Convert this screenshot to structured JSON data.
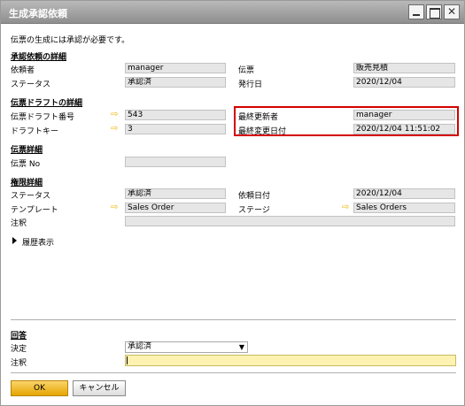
{
  "window": {
    "title": "生成承認依頼"
  },
  "info_text": "伝票の生成には承認が必要です。",
  "approval_details": {
    "heading": "承認依頼の詳細",
    "requester_label": "依頼者",
    "requester_value": "manager",
    "document_label": "伝票",
    "document_value": "販売見積",
    "status_label": "ステータス",
    "status_value": "承認済",
    "issue_date_label": "発行日",
    "issue_date_value": "2020/12/04"
  },
  "draft_details": {
    "heading": "伝票ドラフトの詳細",
    "draft_number_label": "伝票ドラフト番号",
    "draft_number_value": "543",
    "draft_key_label": "ドラフトキー",
    "draft_key_value": "3",
    "last_updated_by_label": "最終更新者",
    "last_updated_by_value": "manager",
    "last_modified_label": "最終変更日付",
    "last_modified_value": "2020/12/04 11:51:02"
  },
  "document_details": {
    "heading": "伝票詳細",
    "doc_no_label": "伝票 No",
    "doc_no_value": ""
  },
  "authorization_details": {
    "heading": "権限詳細",
    "status_label": "ステータス",
    "status_value": "承認済",
    "request_date_label": "依頼日付",
    "request_date_value": "2020/12/04",
    "template_label": "テンプレート",
    "template_value": "Sales Order",
    "stage_label": "ステージ",
    "stage_value": "Sales Orders",
    "remarks_label": "注釈",
    "remarks_value": ""
  },
  "history_toggle": "履歴表示",
  "answer": {
    "heading": "回答",
    "decision_label": "決定",
    "decision_value": "承認済",
    "remarks_label": "注釈",
    "remarks_value": ""
  },
  "buttons": {
    "ok": "OK",
    "cancel": "キャンセル"
  },
  "colors": {
    "highlight_border": "#d40000",
    "ok_button": "#f0b400",
    "active_field": "#fdf2b2",
    "link_arrow": "#f0b400"
  }
}
